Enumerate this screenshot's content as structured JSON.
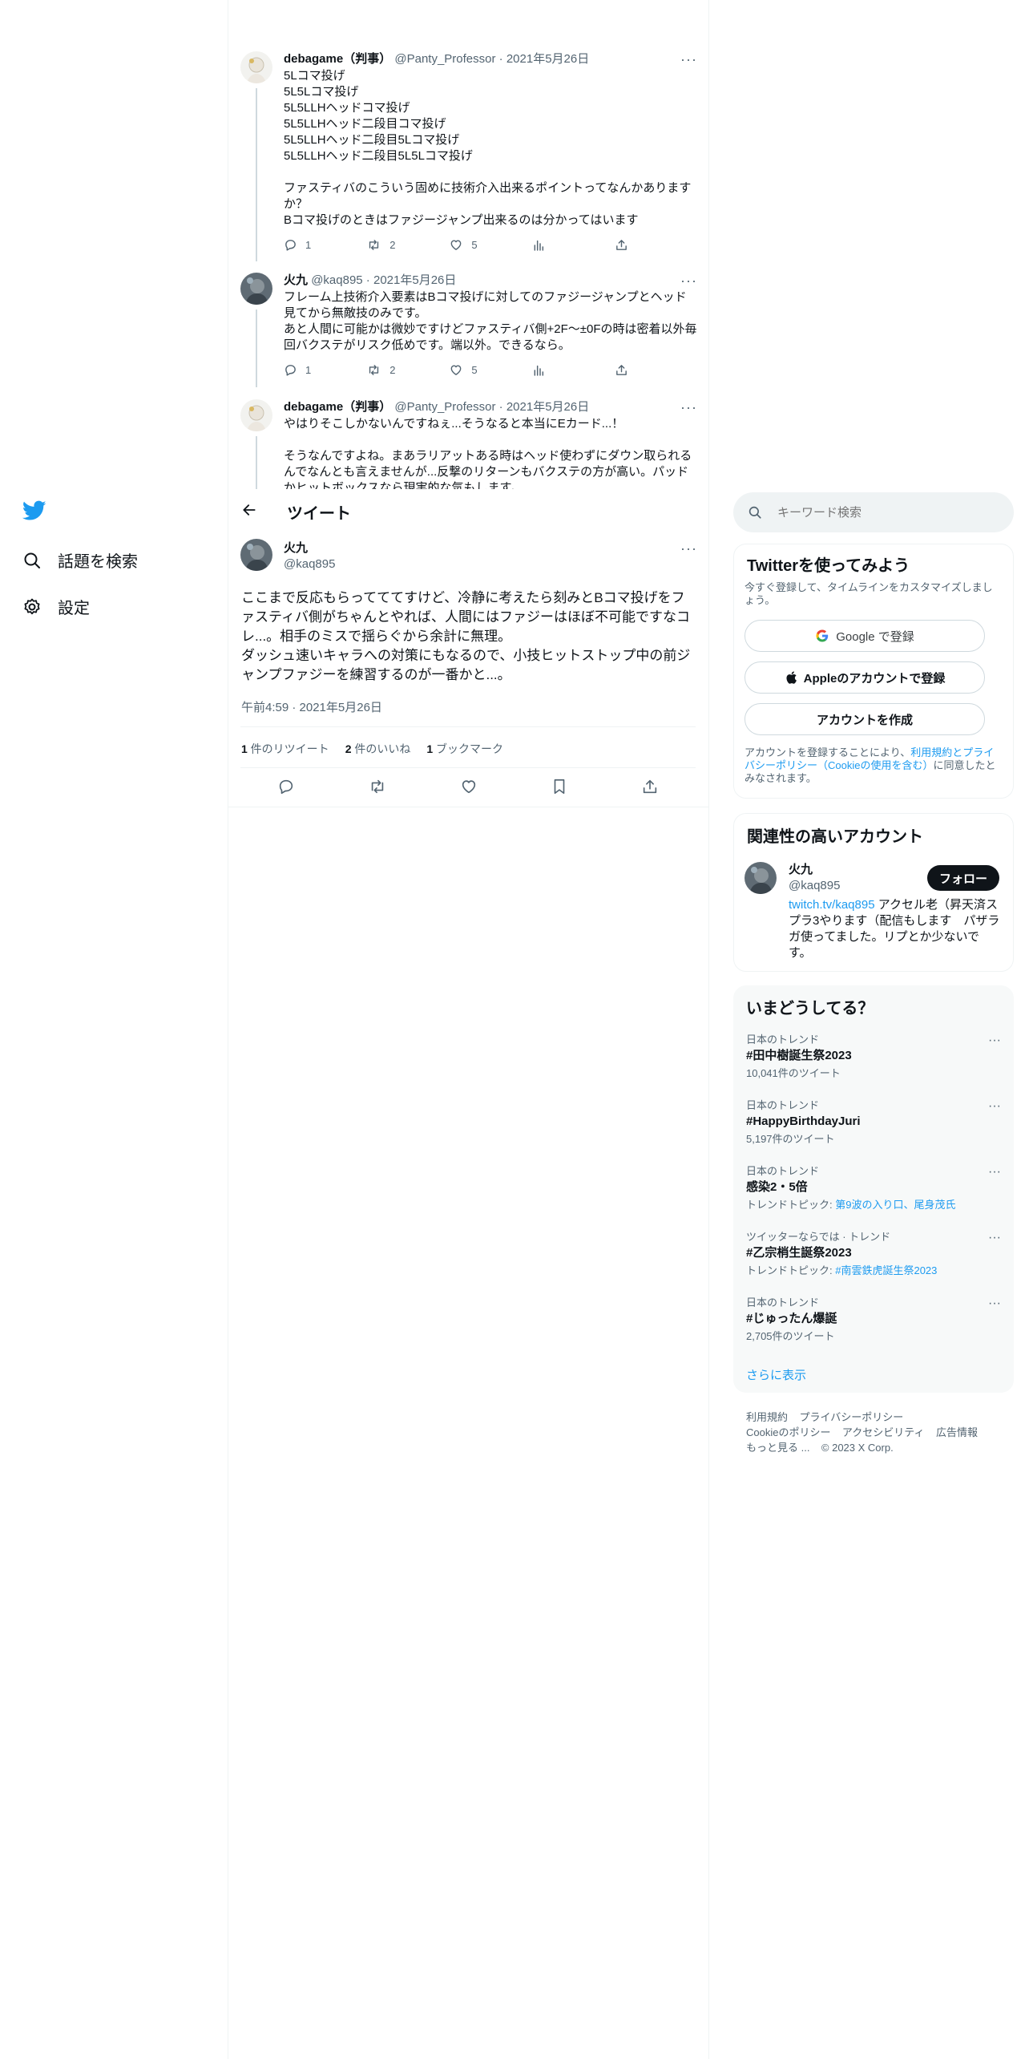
{
  "nav": {
    "explore_label": "話題を検索",
    "settings_label": "設定"
  },
  "thread": [
    {
      "name": "debagame（判事）",
      "handle": "@Panty_Professor",
      "sep": " · ",
      "date": "2021年5月26日",
      "text": "5Lコマ投げ\n5L5Lコマ投げ\n5L5LLHヘッドコマ投げ\n5L5LLHヘッド二段目コマ投げ\n5L5LLHヘッド二段目5Lコマ投げ\n5L5LLHヘッド二段目5L5Lコマ投げ\n\nファスティバのこういう固めに技術介入出来るポイントってなんかありますか？\nBコマ投げのときはファジージャンプ出来るのは分かってはいます",
      "replies": "1",
      "retweets": "2",
      "likes": "5"
    },
    {
      "name": "火九",
      "handle": "@kaq895",
      "sep": " · ",
      "date": "2021年5月26日",
      "text": "フレーム上技術介入要素はBコマ投げに対してのファジージャンプとヘッド見てから無敵技のみです。\nあと人間に可能かは微妙ですけどファスティバ側+2F〜±0Fの時は密着以外毎回バクステがリスク低めです。端以外。できるなら。",
      "replies": "1",
      "retweets": "2",
      "likes": "5"
    },
    {
      "name": "debagame（判事）",
      "handle": "@Panty_Professor",
      "sep": " · ",
      "date": "2021年5月26日",
      "text": "やはりそこしかないんですねぇ...そうなると本当にEカード...！\n\nそうなんですよね。まあラリアットある時はヘッド使わずにダウン取られるんでなんとも言えませんが...反撃のリターンもバクステの方が高い。パッドかヒットボックスなら現実的な気もします。"
    }
  ],
  "header": {
    "title": "ツイート"
  },
  "main_tweet": {
    "name": "火九",
    "handle": "@kaq895",
    "text": "ここまで反応もらってててすけど、冷静に考えたら刻みとBコマ投げをファスティバ側がちゃんとやれば、人間にはファジーはほぼ不可能ですなコレ...。相手のミスで揺らぐから余計に無理。\nダッシュ速いキャラへの対策にもなるので、小技ヒットストップ中の前ジャンプファジーを練習するのが一番かと...。",
    "timestamp": "午前4:59 · 2021年5月26日",
    "retweet_count": "1",
    "retweet_label": " 件のリツイート",
    "like_count": "2",
    "like_label": " 件のいいね",
    "bookmark_count": "1",
    "bookmark_label": " ブックマーク"
  },
  "search": {
    "placeholder": "キーワード検索"
  },
  "signup": {
    "title": "Twitterを使ってみよう",
    "subtitle": "今すぐ登録して、タイムラインをカスタマイズしましょう。",
    "google_label": "Google で登録",
    "apple_label": "Appleのアカウントで登録",
    "create_label": "アカウントを作成",
    "terms_prefix": "アカウントを登録することにより、",
    "terms_link": "利用規約とプライバシーポリシー（Cookieの使用を含む）",
    "terms_suffix": "に同意したとみなされます。"
  },
  "relevant": {
    "title": "関連性の高いアカウント",
    "name": "火九",
    "handle": "@kaq895",
    "follow_label": "フォロー",
    "bio_link": "twitch.tv/kaq895",
    "bio_text": " アクセル老（昇天済スプラ3やります（配信もします　パザラガ使ってました。リプとか少ないです。"
  },
  "trends": {
    "title": "いまどうしてる？",
    "items": [
      {
        "context": "日本のトレンド",
        "name": "#田中樹誕生祭2023",
        "sub": "10,041件のツイート"
      },
      {
        "context": "日本のトレンド",
        "name": "#HappyBirthdayJuri",
        "sub": "5,197件のツイート"
      },
      {
        "context": "日本のトレンド",
        "name": "感染2・5倍",
        "sub_prefix": "トレンドトピック: ",
        "sub_link": "第9波の入り口、尾身茂氏"
      },
      {
        "context": "ツイッターならでは · トレンド",
        "name": "#乙宗梢生誕祭2023",
        "sub_prefix": "トレンドトピック: ",
        "sub_link": "#南雲鉄虎誕生祭2023"
      },
      {
        "context": "日本のトレンド",
        "name": "#じゅったん爆誕",
        "sub": "2,705件のツイート"
      }
    ],
    "show_more": "さらに表示"
  },
  "footer": {
    "terms": "利用規約",
    "privacy": "プライバシーポリシー",
    "cookies": "Cookieのポリシー",
    "accessibility": "アクセシビリティ",
    "ads": "広告情報",
    "more": "もっと見る ...",
    "copyright": "© 2023 X Corp."
  },
  "colors": {
    "brand": "#1d9bf0",
    "text": "#0f1419",
    "muted": "#536471",
    "border": "#eff3f4",
    "card_bg": "#f7f9f9"
  }
}
